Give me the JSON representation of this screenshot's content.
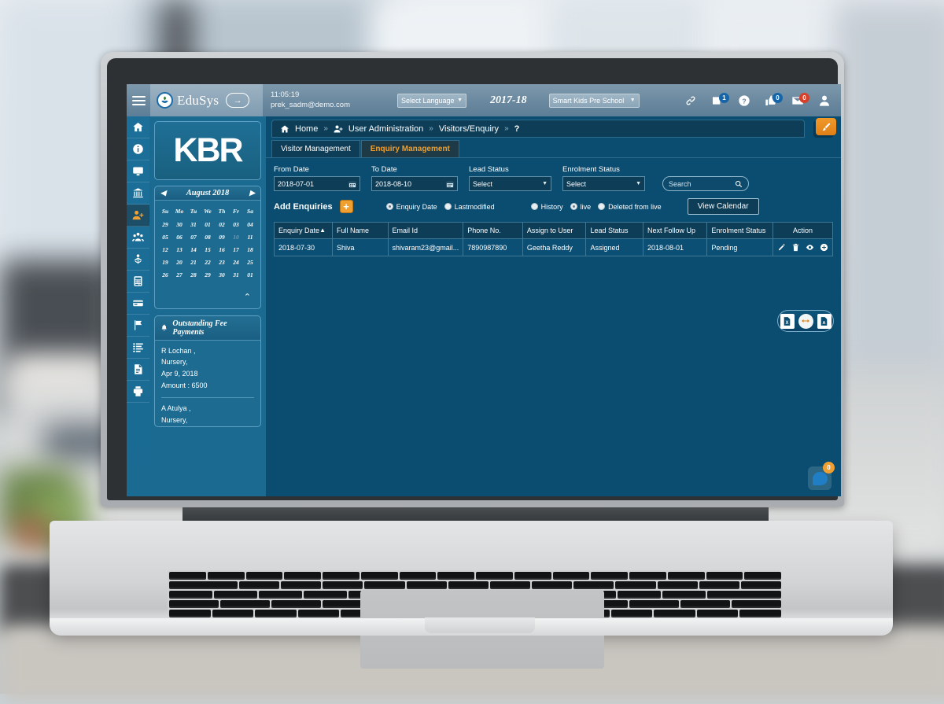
{
  "app": {
    "brand": "EduSys",
    "session_year": "2017-18",
    "time": "11:05:19",
    "user_email": "prek_sadm@demo.com",
    "language_select": "Select Language",
    "school_select": "Smart Kids Pre School"
  },
  "topbar": {
    "icons": [
      {
        "name": "link-icon",
        "badge": null
      },
      {
        "name": "notes-icon",
        "badge": "1",
        "badge_color": "#1565a8"
      },
      {
        "name": "help-icon",
        "badge": null
      },
      {
        "name": "thumbs-up-icon",
        "badge": "0",
        "badge_color": "#1565a8"
      },
      {
        "name": "mail-icon",
        "badge": "0",
        "badge_color": "#d9402a"
      },
      {
        "name": "user-icon",
        "badge": null
      }
    ]
  },
  "rail": {
    "items": [
      {
        "name": "home-icon",
        "label": "Home",
        "active": false
      },
      {
        "name": "info-icon",
        "label": "Information",
        "active": false
      },
      {
        "name": "monitor-icon",
        "label": "Dashboard",
        "active": false
      },
      {
        "name": "bank-icon",
        "label": "Institution",
        "active": false
      },
      {
        "name": "user-admin-icon",
        "label": "User Administration",
        "active": true
      },
      {
        "name": "group-icon",
        "label": "Groups",
        "active": false
      },
      {
        "name": "student-icon",
        "label": "Students",
        "active": false
      },
      {
        "name": "calculator-icon",
        "label": "Accounts",
        "active": false
      },
      {
        "name": "card-icon",
        "label": "Payments",
        "active": false
      },
      {
        "name": "flag-icon",
        "label": "Events",
        "active": false
      },
      {
        "name": "list-icon",
        "label": "Reports",
        "active": false
      },
      {
        "name": "document-icon",
        "label": "Documents",
        "active": false
      },
      {
        "name": "printer-icon",
        "label": "Print",
        "active": false
      }
    ]
  },
  "sidebar": {
    "school_logo_text": "KBR",
    "calendar": {
      "title": "August 2018",
      "prev": "◀",
      "next": "▶",
      "dow": [
        "Su",
        "Mo",
        "Tu",
        "We",
        "Th",
        "Fr",
        "Sa"
      ],
      "weeks": [
        [
          "29",
          "30",
          "31",
          "01",
          "02",
          "03",
          "04"
        ],
        [
          "05",
          "06",
          "07",
          "08",
          "09",
          "10",
          "11"
        ],
        [
          "12",
          "13",
          "14",
          "15",
          "16",
          "17",
          "18"
        ],
        [
          "19",
          "20",
          "21",
          "22",
          "23",
          "24",
          "25"
        ],
        [
          "26",
          "27",
          "28",
          "29",
          "30",
          "31",
          "01"
        ]
      ],
      "muted_cell": "10",
      "collapse": "⌃"
    },
    "fee_panel": {
      "title": "Outstanding Fee Payments",
      "bell_icon": "bell-icon",
      "entries": [
        {
          "name": "R Lochan ,",
          "grade": "Nursery,",
          "date": "Apr 9, 2018",
          "amount": "Amount : 6500"
        },
        {
          "name": "A Atulya ,",
          "grade": "Nursery,",
          "date": "",
          "amount": ""
        }
      ]
    }
  },
  "breadcrumb": {
    "home": "Home",
    "section": "User Administration",
    "page": "Visitors/Enquiry",
    "help": "?",
    "separator": "»"
  },
  "tabs": [
    {
      "label": "Visitor Management",
      "active": false
    },
    {
      "label": "Enquiry Management",
      "active": true
    }
  ],
  "filters": {
    "from_date": {
      "label": "From Date",
      "value": "2018-07-01"
    },
    "to_date": {
      "label": "To Date",
      "value": "2018-08-10"
    },
    "lead_status": {
      "label": "Lead Status",
      "value": "Select"
    },
    "enrolment_status": {
      "label": "Enrolment Status",
      "value": "Select"
    },
    "search": {
      "placeholder": "Search",
      "value": "Search"
    }
  },
  "actions": {
    "add_enquiries_label": "Add Enquiries",
    "add_plus": "+",
    "view_calendar": "View Calendar",
    "radio_group_1": [
      {
        "label": "Enquiry Date",
        "selected": true
      },
      {
        "label": "Lastmodified",
        "selected": false
      }
    ],
    "radio_group_2": [
      {
        "label": "History",
        "selected": false
      },
      {
        "label": "live",
        "selected": true
      },
      {
        "label": "Deleted from live",
        "selected": false
      }
    ],
    "export_excel": "X",
    "export_resize": "↔",
    "export_pdf": "A"
  },
  "table": {
    "columns": [
      "Enquiry Date",
      "Full Name",
      "Email Id",
      "Phone No.",
      "Assign to User",
      "Lead Status",
      "Next Follow Up",
      "Enrolment Status",
      "Action"
    ],
    "sort_column": "Enquiry Date",
    "sort_mark": "▲",
    "rows": [
      {
        "enquiry_date": "2018-07-30",
        "full_name": "Shiva",
        "email": "shivaram23@gmail...",
        "phone": "7890987890",
        "assign_to_user": "Geetha Reddy",
        "lead_status": "Assigned",
        "next_follow_up": "2018-08-01",
        "enrolment_status": "Pending"
      }
    ],
    "row_actions": [
      "edit-icon",
      "delete-icon",
      "view-icon",
      "add-icon"
    ]
  },
  "chat": {
    "badge": "0",
    "icon": "chat-bubble-icon"
  },
  "colors": {
    "accent_orange": "#f0a030",
    "content_bg": "#0a4d71",
    "sidebar_bg": "#1a6a92",
    "header_bg": "#6d8ba1",
    "badge_red": "#d9402a",
    "badge_blue": "#1565a8"
  }
}
